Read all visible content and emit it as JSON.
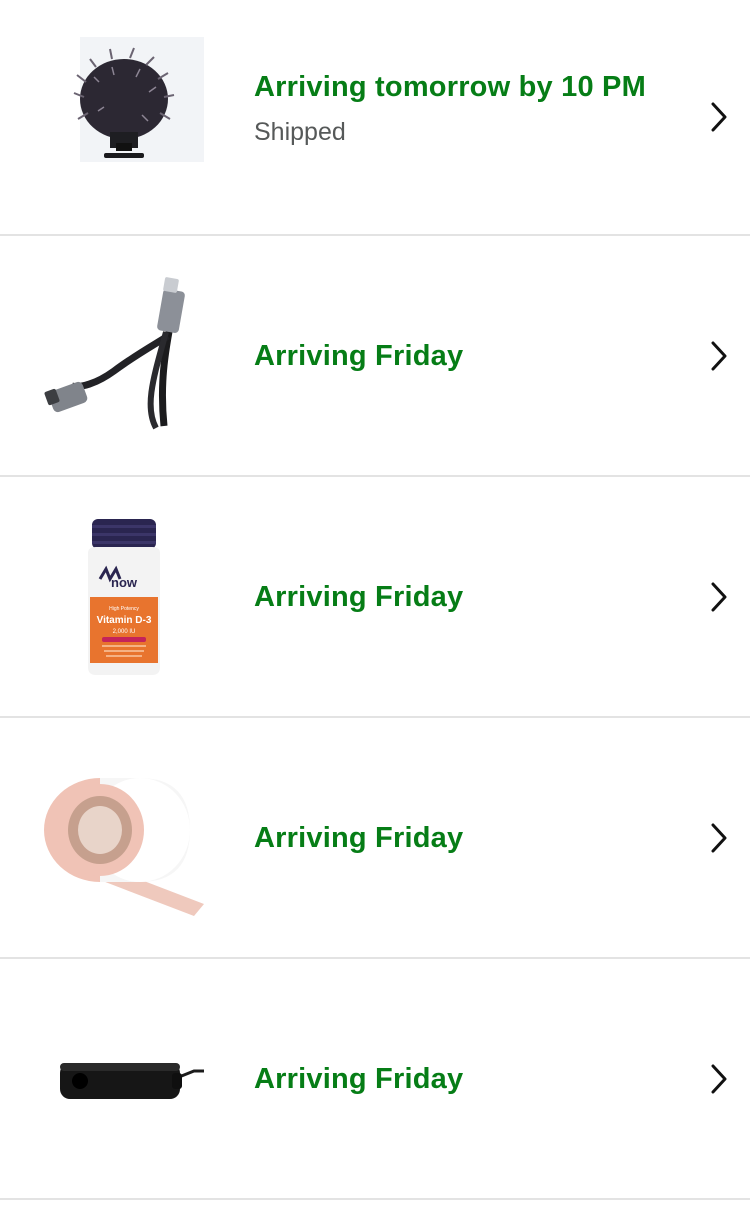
{
  "orders": [
    {
      "status": "Arriving tomorrow by 10 PM",
      "substatus": "Shipped",
      "image_icon": "microphone-windscreen-image"
    },
    {
      "status": "Arriving Friday",
      "image_icon": "usb-c-extension-cable-image"
    },
    {
      "status": "Arriving Friday",
      "image_icon": "vitamin-d3-bottle-image",
      "product_label_brand": "now",
      "product_label_name": "Vitamin D-3",
      "product_label_strength": "2,000 IU",
      "product_label_top": "High Potency"
    },
    {
      "status": "Arriving Friday",
      "image_icon": "tape-roll-image"
    },
    {
      "status": "Arriving Friday",
      "image_icon": "lavalier-mic-foam-image"
    }
  ],
  "colors": {
    "status_green": "#067d16",
    "substatus_gray": "#565959",
    "divider": "#e3e3e3"
  }
}
